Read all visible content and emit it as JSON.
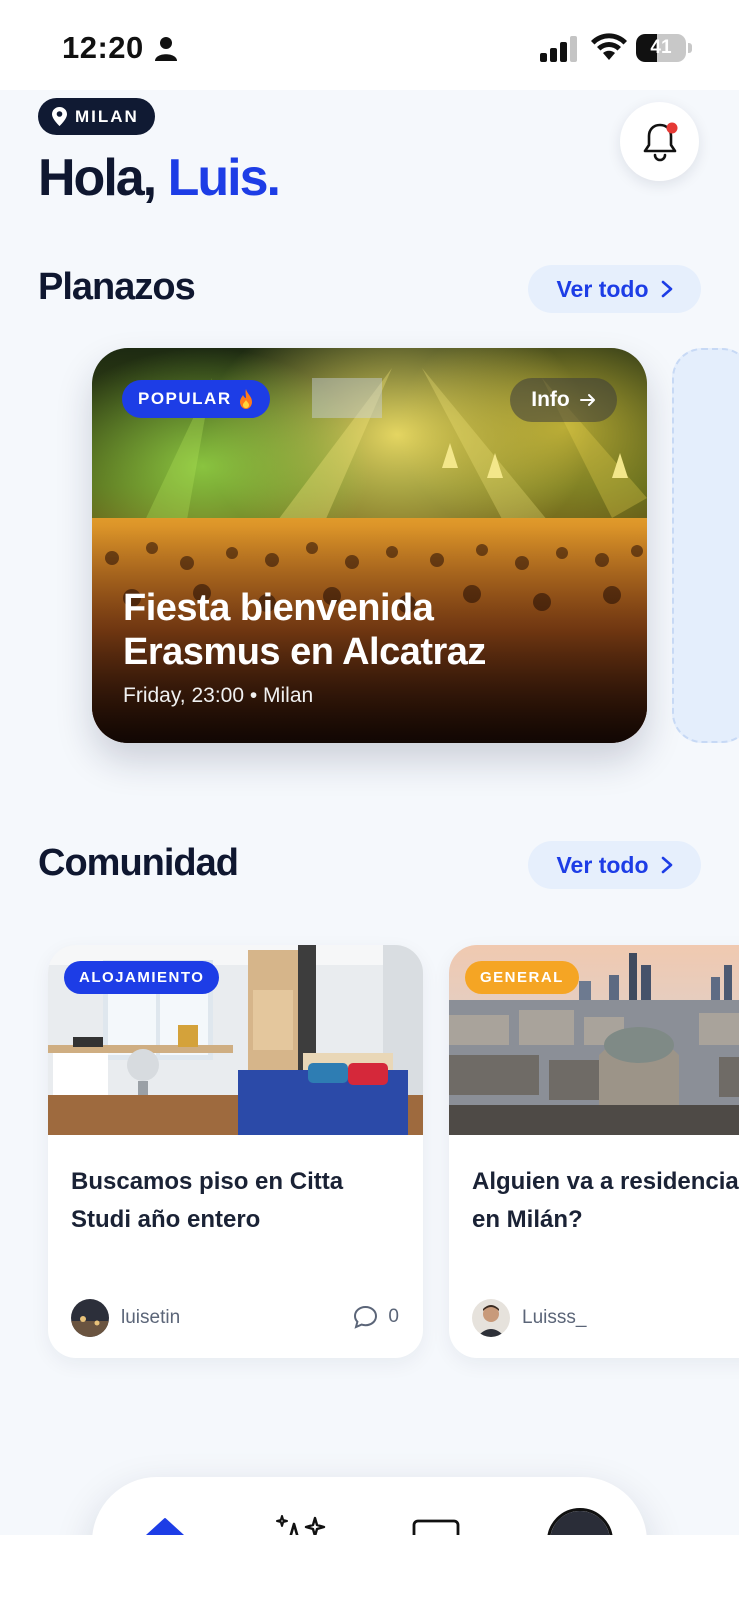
{
  "status_bar": {
    "time": "12:20",
    "battery_level": "41",
    "battery_fraction": 0.41
  },
  "header": {
    "location": "MILAN",
    "greeting": "Hola,",
    "user_name": "Luis."
  },
  "planazos": {
    "title": "Planazos",
    "see_all": "Ver todo",
    "featured": {
      "badge": "POPULAR",
      "info_label": "Info",
      "title": "Fiesta bienvenida Erasmus en Alcatraz",
      "meta": "Friday, 23:00 • Milan"
    }
  },
  "comunidad": {
    "title": "Comunidad",
    "see_all": "Ver todo",
    "posts": [
      {
        "category": "ALOJAMIENTO",
        "category_color": "#1d3de6",
        "title_line1": "Buscamos piso en Citta",
        "title_line2": "Studi año entero",
        "author": "luisetin",
        "comments": "0"
      },
      {
        "category": "GENERAL",
        "category_color": "#f5a524",
        "title_line1": "Alguien va a residencia",
        "title_line2": "en Milán?",
        "author": "Luisss_"
      }
    ]
  },
  "bottom_nav": {
    "items": [
      "home-icon",
      "sparkles-icon",
      "chat-icon",
      "profile-avatar"
    ],
    "active": "home-icon",
    "accent": "#1d3de6"
  }
}
